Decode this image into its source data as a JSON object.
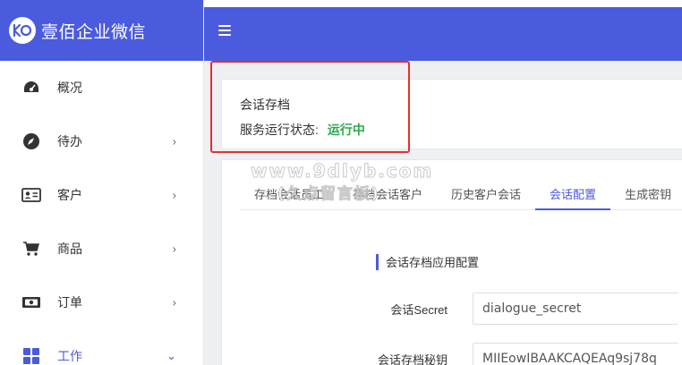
{
  "brand": {
    "title": "壹佰企业微信",
    "logo_text": "KO"
  },
  "colors": {
    "primary": "#4b5bde",
    "status_green": "#2fa84f",
    "highlight_red": "#e5302a"
  },
  "sidebar": {
    "items": [
      {
        "label": "概况",
        "icon": "dashboard-icon",
        "has_chevron": false
      },
      {
        "label": "待办",
        "icon": "compass-icon",
        "has_chevron": true,
        "chevron": "›"
      },
      {
        "label": "客户",
        "icon": "contact-card-icon",
        "has_chevron": true,
        "chevron": "›"
      },
      {
        "label": "商品",
        "icon": "cart-icon",
        "has_chevron": true,
        "chevron": "›"
      },
      {
        "label": "订单",
        "icon": "money-icon",
        "has_chevron": true,
        "chevron": "›"
      },
      {
        "label": "工作",
        "icon": "grid-icon",
        "has_chevron": true,
        "chevron": "⌄",
        "active": true
      }
    ]
  },
  "topbar": {
    "menu_icon": "hamburger-icon"
  },
  "status": {
    "title": "会话存档",
    "label": "服务运行状态:",
    "value": "运行中"
  },
  "tabs": [
    {
      "label": "存档会话员工"
    },
    {
      "label": "存档会话客户"
    },
    {
      "label": "历史客户会话"
    },
    {
      "label": "会话配置",
      "active": true
    },
    {
      "label": "生成密钥"
    }
  ],
  "config": {
    "section_title": "会话存档应用配置",
    "fields": [
      {
        "label": "会话Secret",
        "value": "dialogue_secret"
      },
      {
        "label": "会话存档秘钥",
        "value": "MIIEowIBAAKCAQEAq9sj78q"
      }
    ]
  },
  "watermark": {
    "line1": "www.9dlyb.com",
    "line2": "(久点留言板)"
  }
}
